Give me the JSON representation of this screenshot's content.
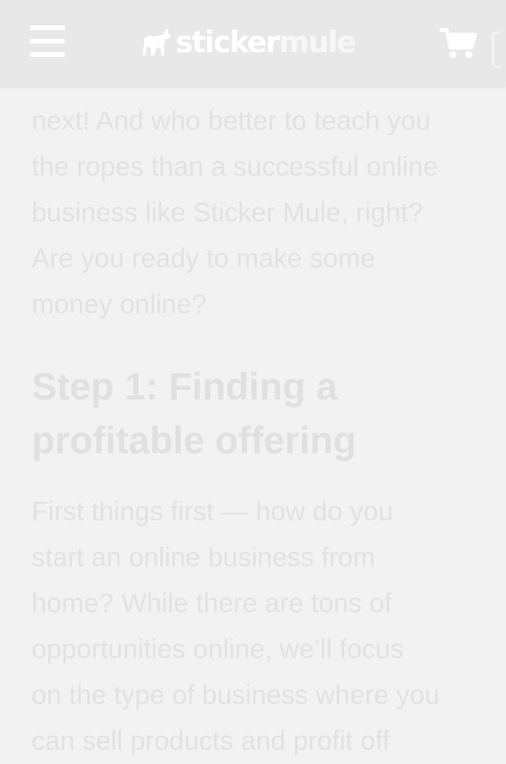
{
  "header": {
    "logo": {
      "brand_primary": "sticker",
      "brand_secondary": "mule"
    },
    "icons": {
      "menu": "hamburger-menu-icon",
      "cart": "shopping-cart-icon",
      "logo_mark": "mule-icon"
    }
  },
  "article": {
    "intro_lines": [
      "next! And who better to teach you",
      "the ropes than a successful online",
      "business like Sticker Mule, right?",
      "Are you ready to make some",
      "money online?"
    ],
    "step1_heading_lines": [
      "Step 1: Finding a",
      "profitable offering"
    ],
    "step1_body_lines": [
      "First things first — how do you",
      "start an online business from",
      "home? While there are tons of",
      "opportunities online, we’ll focus",
      "on the type of business where you",
      "can sell products and profit off"
    ]
  },
  "colors": {
    "header_bg": "#e8e8e8",
    "page_bg": "#f2f2f2",
    "text": "#e2e2e2"
  }
}
